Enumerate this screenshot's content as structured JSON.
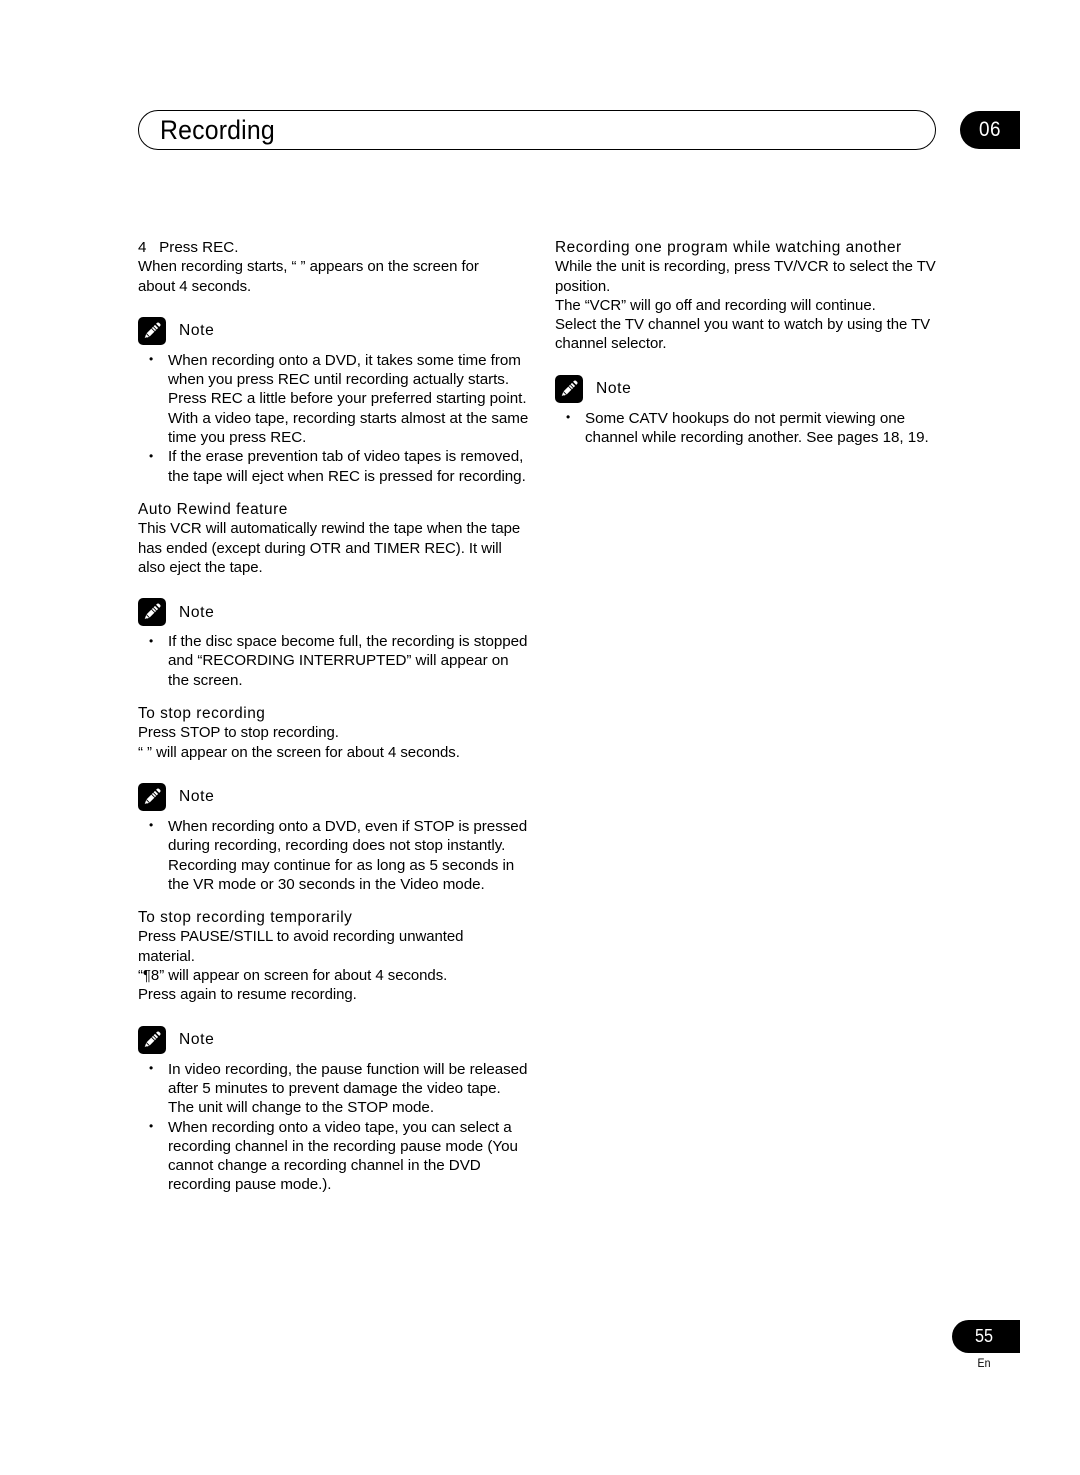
{
  "header": {
    "title": "Recording",
    "chapter_number": "06"
  },
  "footer": {
    "page_number": "55",
    "language": "En"
  },
  "note_label": "Note",
  "left_column": {
    "step": {
      "number": "4",
      "label": "Press REC.",
      "line1": "When recording starts, “       ” appears on the screen for",
      "line2": "about 4 seconds."
    },
    "note1": {
      "bullets": [
        "When recording onto a DVD, it takes some time from when you press REC until recording actually starts.",
        "Press REC a little before your preferred starting point.",
        "With a video tape, recording starts almost at the same time you press REC.",
        "If the erase prevention tab of video tapes is removed, the tape will eject when REC is pressed for recording."
      ]
    },
    "auto_rewind": {
      "heading": "Auto Rewind feature",
      "body": "This VCR will automatically rewind the tape when the tape has ended (except during OTR and TIMER REC). It will also eject the tape."
    },
    "note2": {
      "bullets": [
        "If the disc space become full, the recording is stopped and “RECORDING INTERRUPTED” will appear on the screen."
      ]
    },
    "stop_recording": {
      "heading": "To stop recording",
      "line1": "Press STOP to stop recording.",
      "line2": "“      ” will appear on the screen for about 4 seconds."
    },
    "note3": {
      "bullets": [
        "When recording onto a DVD, even if STOP is pressed during recording, recording does not stop instantly. Recording may continue for as long as 5 seconds in the VR mode or 30 seconds in the Video mode."
      ]
    },
    "stop_temporarily": {
      "heading": "To stop recording temporarily",
      "line1": "Press PAUSE/STILL to avoid recording unwanted material.",
      "line2": "“¶8” will appear on screen for about 4 seconds.",
      "line3": "Press again to resume recording."
    },
    "note4": {
      "bullets": [
        "In video recording, the pause function will be released after 5 minutes to prevent damage the video tape. The unit will change to the STOP mode.",
        "When recording onto a video tape, you can select a recording channel in the recording pause mode (You cannot change a recording channel in the DVD recording pause mode.)."
      ]
    }
  },
  "right_column": {
    "watch_another": {
      "heading": "Recording one program while watching another",
      "line1": "While the unit is recording, press TV/VCR to select the TV position.",
      "line2": "The “VCR” will go off and recording will continue.",
      "line3": "Select the TV channel you want to watch by using the TV channel selector."
    },
    "note5": {
      "bullets": [
        "Some CATV hookups do not permit viewing one channel while recording another. See pages 18, 19."
      ]
    }
  }
}
